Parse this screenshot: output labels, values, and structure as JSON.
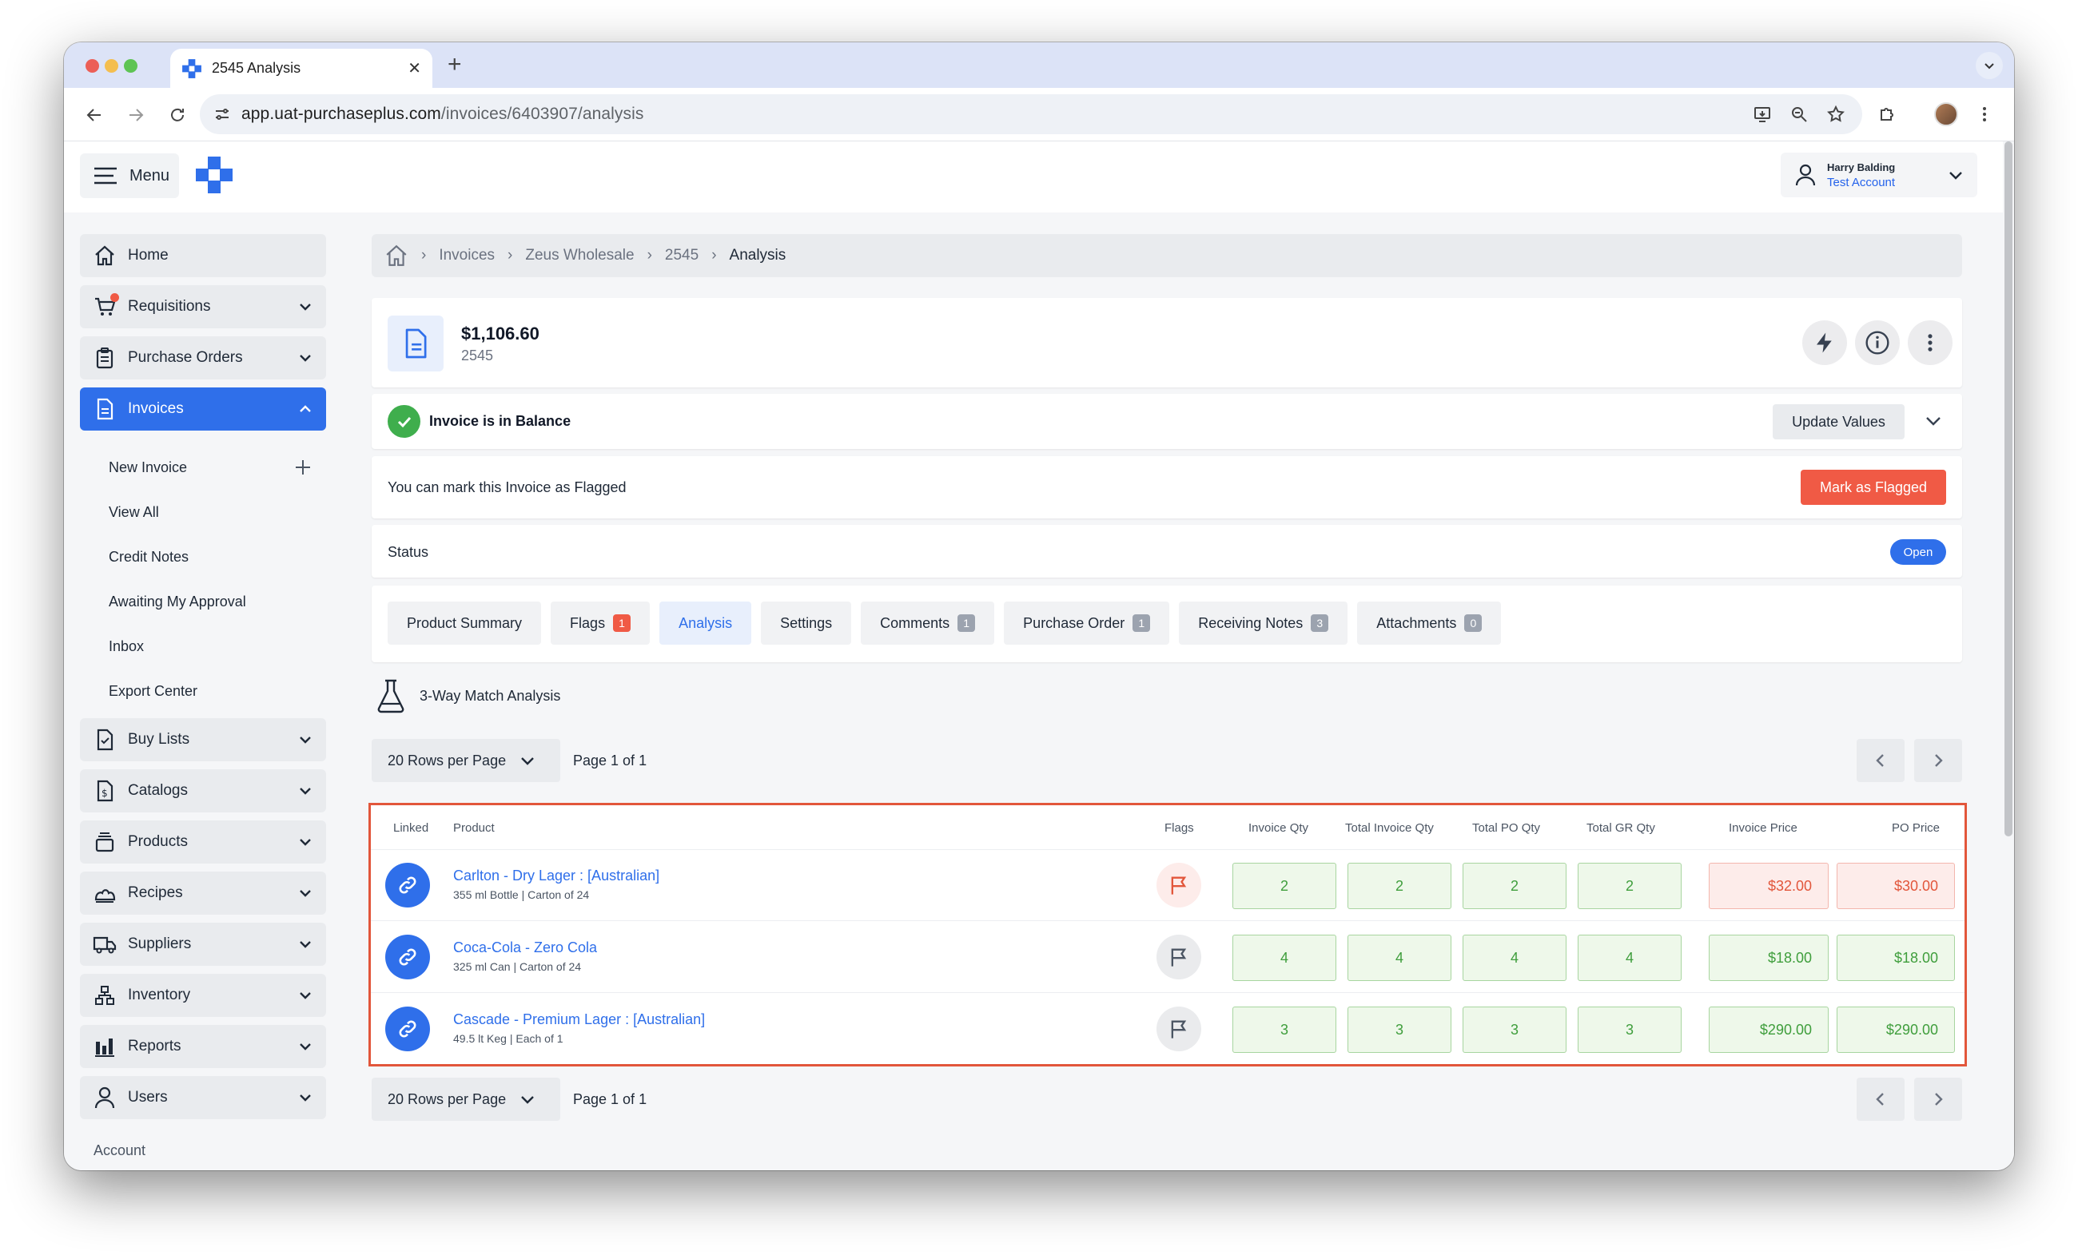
{
  "browser": {
    "tab_title": "2545 Analysis",
    "url_host": "app.uat-purchaseplus.com",
    "url_path": "/invoices/6403907/analysis"
  },
  "header": {
    "menu_label": "Menu",
    "user_name": "Harry Balding",
    "user_account": "Test Account"
  },
  "sidebar": {
    "items": [
      {
        "label": "Home",
        "icon": "home-icon"
      },
      {
        "label": "Requisitions",
        "icon": "cart-icon"
      },
      {
        "label": "Purchase Orders",
        "icon": "clipboard-icon"
      },
      {
        "label": "Invoices",
        "icon": "document-icon"
      },
      {
        "label": "Buy Lists",
        "icon": "checklist-icon"
      },
      {
        "label": "Catalogs",
        "icon": "dollar-document-icon"
      },
      {
        "label": "Products",
        "icon": "box-stack-icon"
      },
      {
        "label": "Recipes",
        "icon": "cooking-pot-icon"
      },
      {
        "label": "Suppliers",
        "icon": "truck-icon"
      },
      {
        "label": "Inventory",
        "icon": "hierarchy-icon"
      },
      {
        "label": "Reports",
        "icon": "bar-chart-icon"
      },
      {
        "label": "Users",
        "icon": "user-icon"
      }
    ],
    "invoice_sub": [
      "New Invoice",
      "View All",
      "Credit Notes",
      "Awaiting My Approval",
      "Inbox",
      "Export Center"
    ],
    "footer": "Account"
  },
  "breadcrumb": [
    "Invoices",
    "Zeus Wholesale",
    "2545",
    "Analysis"
  ],
  "invoice": {
    "amount": "$1,106.60",
    "number": "2545"
  },
  "balance": {
    "text": "Invoice is in Balance",
    "update_label": "Update Values"
  },
  "flagging": {
    "text": "You can mark this Invoice as Flagged",
    "button": "Mark as Flagged"
  },
  "status": {
    "label": "Status",
    "value": "Open"
  },
  "tabs": [
    {
      "label": "Product Summary",
      "count": null
    },
    {
      "label": "Flags",
      "count": "1"
    },
    {
      "label": "Analysis",
      "count": null
    },
    {
      "label": "Settings",
      "count": null
    },
    {
      "label": "Comments",
      "count": "1"
    },
    {
      "label": "Purchase Order",
      "count": "1"
    },
    {
      "label": "Receiving Notes",
      "count": "3"
    },
    {
      "label": "Attachments",
      "count": "0"
    }
  ],
  "analysis": {
    "title": "3-Way Match Analysis"
  },
  "pager": {
    "rows_label": "20 Rows per Page",
    "page_label": "Page 1 of 1"
  },
  "table": {
    "headers": [
      "Linked",
      "Product",
      "Flags",
      "Invoice Qty",
      "Total Invoice Qty",
      "Total PO Qty",
      "Total GR Qty",
      "Invoice Price",
      "PO Price"
    ],
    "rows": [
      {
        "name": "Carlton - Dry Lager : [Australian]",
        "desc": "355 ml Bottle | Carton of 24",
        "invoice_qty": "2",
        "total_invoice_qty": "2",
        "total_po_qty": "2",
        "total_gr_qty": "2",
        "invoice_price": "$32.00",
        "po_price": "$30.00"
      },
      {
        "name": "Coca-Cola - Zero Cola",
        "desc": "325 ml Can | Carton of 24",
        "invoice_qty": "4",
        "total_invoice_qty": "4",
        "total_po_qty": "4",
        "total_gr_qty": "4",
        "invoice_price": "$18.00",
        "po_price": "$18.00"
      },
      {
        "name": "Cascade - Premium Lager : [Australian]",
        "desc": "49.5 lt Keg | Each of 1",
        "invoice_qty": "3",
        "total_invoice_qty": "3",
        "total_po_qty": "3",
        "total_gr_qty": "3",
        "invoice_price": "$290.00",
        "po_price": "$290.00"
      }
    ]
  },
  "colors": {
    "primary": "#2f6fea",
    "danger": "#f05a45",
    "success": "#3fae4d",
    "match_green": "#3f9e3c",
    "mismatch_red": "#e2563b"
  }
}
